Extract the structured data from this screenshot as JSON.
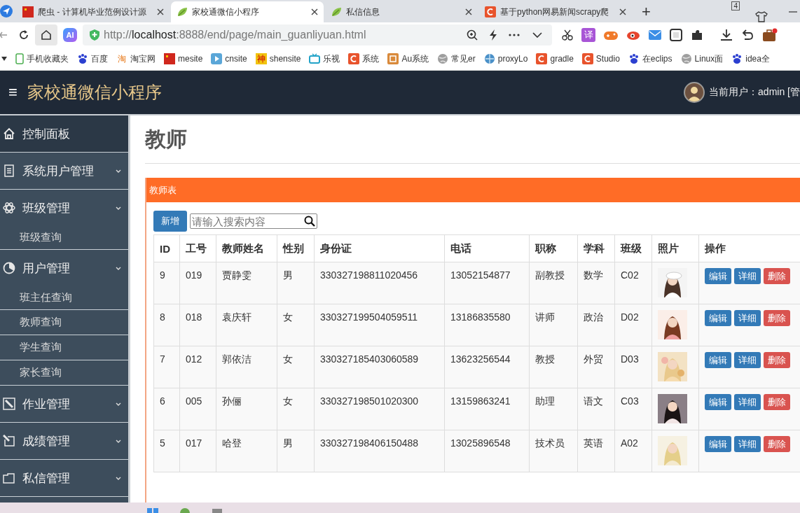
{
  "browser": {
    "tabs": [
      {
        "title": "爬虫 - 计算机毕业范例设计源",
        "selected": false,
        "kind": "red"
      },
      {
        "title": "家校通微信小程序",
        "selected": true,
        "kind": "leaf"
      },
      {
        "title": "私信信息",
        "selected": false,
        "kind": "leaf"
      },
      {
        "title": "基于python网易新闻scrapy爬",
        "selected": false,
        "kind": "c"
      }
    ],
    "new_tab": "+",
    "tab_count": "4",
    "ai_badge": "AI",
    "url": "http://**localhost**:8888/end/page/main_guanliyuan.html",
    "translate_badge": "译",
    "bookmarks": [
      {
        "label": "手机收藏夹",
        "kind": "phone"
      },
      {
        "label": "百度",
        "kind": "paw"
      },
      {
        "label": "淘宝网",
        "kind": "glyph",
        "glyph": "淘"
      },
      {
        "label": "mesite",
        "kind": "red"
      },
      {
        "label": "cnsite",
        "kind": "play"
      },
      {
        "label": "shensite",
        "kind": "glyph",
        "glyph": "神"
      },
      {
        "label": "乐视",
        "kind": "tv"
      },
      {
        "label": "系统",
        "kind": "c"
      },
      {
        "label": "Au系统",
        "kind": "au"
      },
      {
        "label": "常见er",
        "kind": "globe"
      },
      {
        "label": "proxyLo",
        "kind": "proxy"
      },
      {
        "label": "gradle",
        "kind": "c"
      },
      {
        "label": "Studio",
        "kind": "c"
      },
      {
        "label": "在eclips",
        "kind": "paw"
      },
      {
        "label": "Linux面",
        "kind": "globe"
      },
      {
        "label": "idea全",
        "kind": "paw"
      }
    ]
  },
  "app": {
    "menu": "≡",
    "title": "家校通微信小程序",
    "user": "当前用户：admin [管"
  },
  "sidebar": [
    {
      "label": "控制面板",
      "kind": "top"
    },
    {
      "label": "系统用户管理",
      "kind": "group"
    },
    {
      "label": "班级管理",
      "kind": "group",
      "children": [
        {
          "label": "班级查询"
        }
      ]
    },
    {
      "label": "用户管理",
      "kind": "group",
      "children": [
        {
          "label": "班主任查询"
        },
        {
          "label": "教师查询"
        },
        {
          "label": "学生查询"
        },
        {
          "label": "家长查询"
        }
      ]
    },
    {
      "label": "作业管理",
      "kind": "group"
    },
    {
      "label": "成绩管理",
      "kind": "group"
    },
    {
      "label": "私信管理",
      "kind": "group"
    }
  ],
  "page": {
    "title": "教师",
    "panel_title": "教师表",
    "add_button": "新增",
    "search_placeholder": "请输入搜索内容",
    "columns": [
      "ID",
      "工号",
      "教师姓名",
      "性别",
      "身份证",
      "电话",
      "职称",
      "学科",
      "班级",
      "照片",
      "操作"
    ],
    "rows": [
      {
        "cells": [
          "9",
          "019",
          "贾静雯",
          "男",
          "330327198811020456",
          "13052154877",
          "副教授",
          "数学",
          "C02"
        ],
        "photo": {
          "kind": "picture"
        },
        "actions": [
          {
            "label": "编辑",
            "kind": "edit"
          },
          {
            "label": "详细",
            "kind": "detail"
          },
          {
            "label": "删除",
            "kind": "delete"
          }
        ]
      },
      {
        "cells": [
          "8",
          "018",
          "袁庆轩",
          "女",
          "330327199504059511",
          "13186835580",
          "讲师",
          "政治",
          "D02"
        ],
        "photo": {
          "kind": "picture"
        },
        "actions": [
          {
            "label": "编辑",
            "kind": "edit"
          },
          {
            "label": "详细",
            "kind": "detail"
          },
          {
            "label": "删除",
            "kind": "delete"
          }
        ]
      },
      {
        "cells": [
          "7",
          "012",
          "郭依洁",
          "女",
          "330327185403060589",
          "13623256544",
          "教授",
          "外贸",
          "D03"
        ],
        "photo": {
          "kind": "picture"
        },
        "actions": [
          {
            "label": "编辑",
            "kind": "edit"
          },
          {
            "label": "详细",
            "kind": "detail"
          },
          {
            "label": "删除",
            "kind": "delete"
          }
        ]
      },
      {
        "cells": [
          "6",
          "005",
          "孙俪",
          "女",
          "330327198501020300",
          "13159863241",
          "助理",
          "语文",
          "C03"
        ],
        "photo": {
          "kind": "picture"
        },
        "actions": [
          {
            "label": "编辑",
            "kind": "edit"
          },
          {
            "label": "详细",
            "kind": "detail"
          },
          {
            "label": "删除",
            "kind": "delete"
          }
        ]
      },
      {
        "cells": [
          "5",
          "017",
          "哈登",
          "男",
          "330327198406150488",
          "13025896548",
          "技术员",
          "英语",
          "A02"
        ],
        "photo": {
          "kind": "picture"
        },
        "actions": [
          {
            "label": "编辑",
            "kind": "edit"
          },
          {
            "label": "详细",
            "kind": "detail"
          },
          {
            "label": "删除",
            "kind": "delete"
          }
        ]
      }
    ]
  }
}
